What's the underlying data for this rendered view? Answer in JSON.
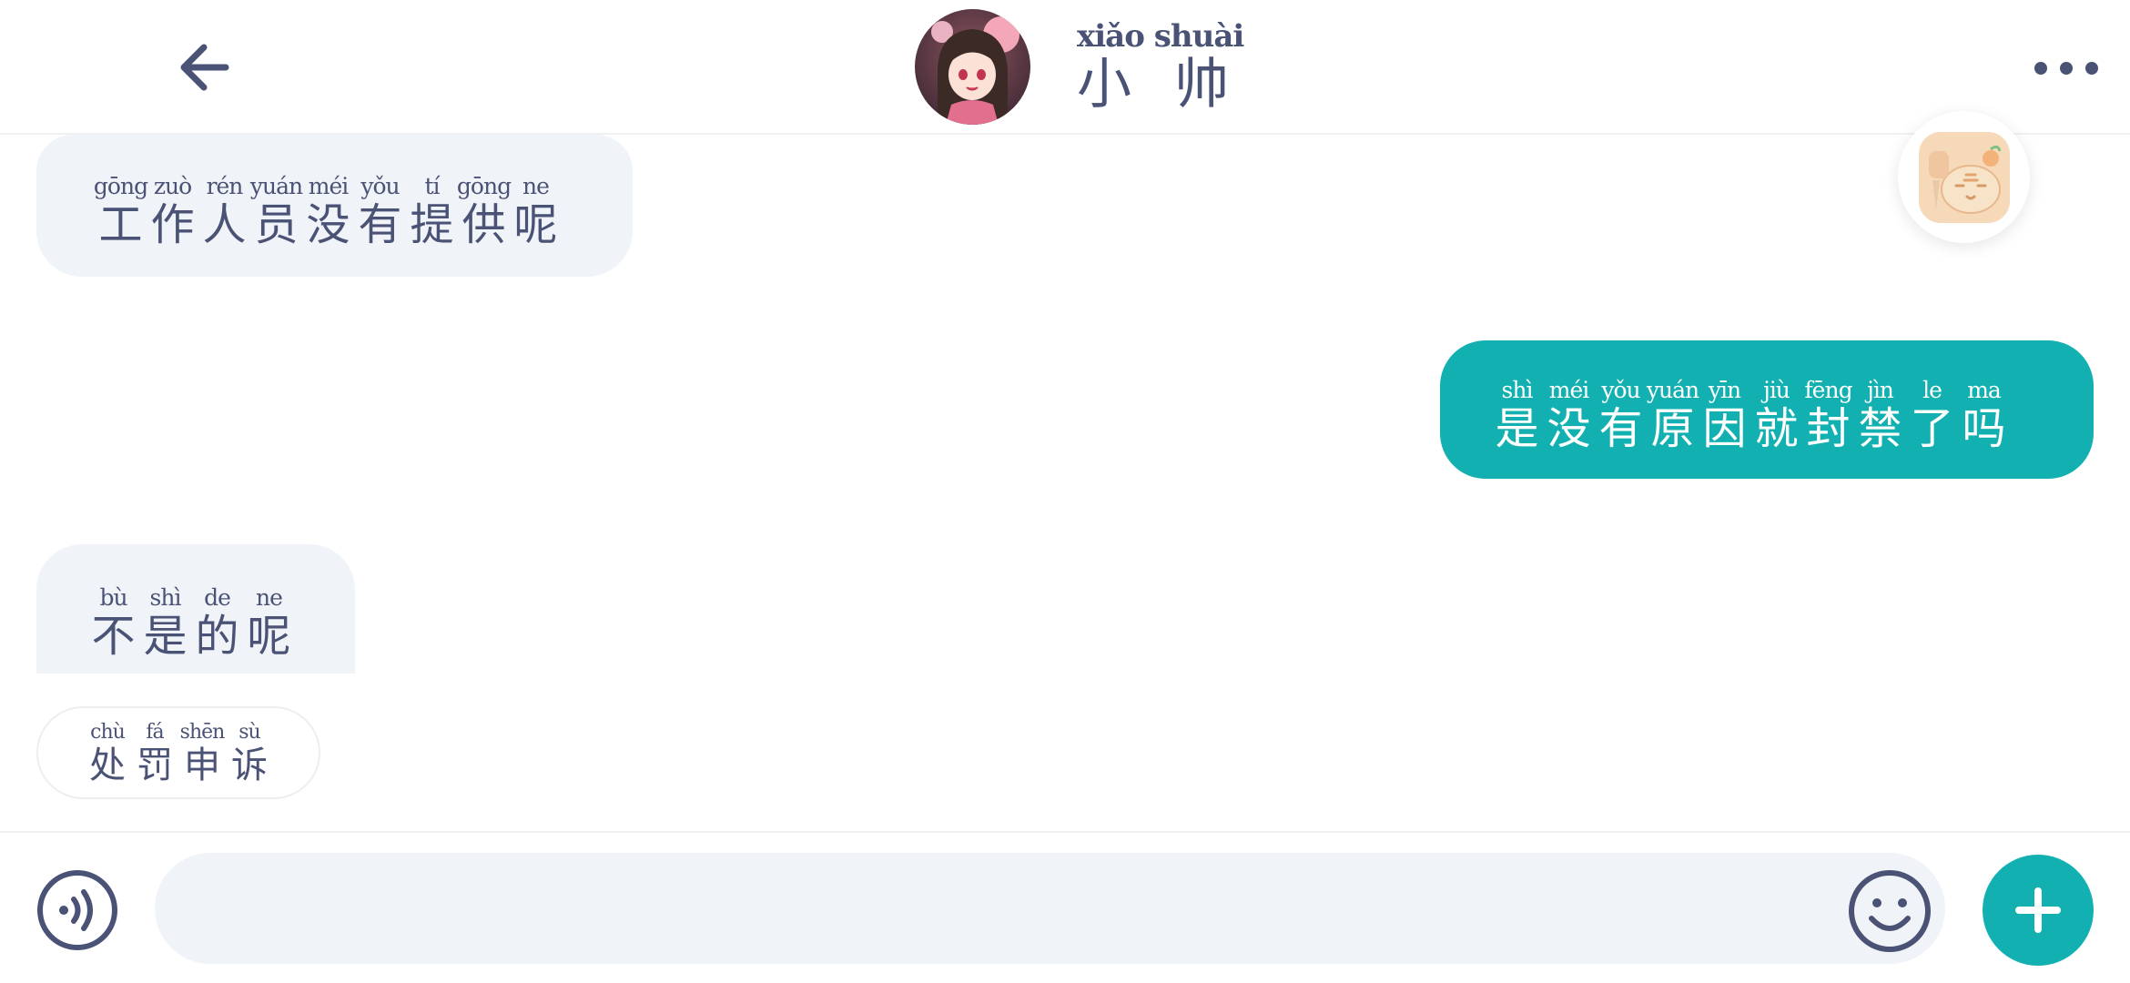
{
  "header": {
    "contact_name_pinyin": "xiǎo shuài",
    "contact_name_hanzi": "小 帅"
  },
  "colors": {
    "accent": "#12b0b0",
    "text": "#4a5275",
    "bubble_in": "#f0f3f7"
  },
  "messages": [
    {
      "direction": "incoming",
      "tokens": [
        {
          "py": "gōng",
          "hz": "工"
        },
        {
          "py": "zuò",
          "hz": "作"
        },
        {
          "py": "rén",
          "hz": "人"
        },
        {
          "py": "yuán",
          "hz": "员"
        },
        {
          "py": "méi",
          "hz": "没"
        },
        {
          "py": "yǒu",
          "hz": "有"
        },
        {
          "py": "tí",
          "hz": "提"
        },
        {
          "py": "gōng",
          "hz": "供"
        },
        {
          "py": "ne",
          "hz": "呢"
        }
      ]
    },
    {
      "direction": "outgoing",
      "tokens": [
        {
          "py": "shì",
          "hz": "是"
        },
        {
          "py": "méi",
          "hz": "没"
        },
        {
          "py": "yǒu",
          "hz": "有"
        },
        {
          "py": "yuán",
          "hz": "原"
        },
        {
          "py": "yīn",
          "hz": "因"
        },
        {
          "py": "jiù",
          "hz": "就"
        },
        {
          "py": "fēng",
          "hz": "封"
        },
        {
          "py": "jìn",
          "hz": "禁"
        },
        {
          "py": "le",
          "hz": "了"
        },
        {
          "py": "ma",
          "hz": "吗"
        }
      ]
    },
    {
      "direction": "incoming",
      "tokens": [
        {
          "py": "bù",
          "hz": "不"
        },
        {
          "py": "shì",
          "hz": "是"
        },
        {
          "py": "de",
          "hz": "的"
        },
        {
          "py": "ne",
          "hz": "呢"
        }
      ]
    }
  ],
  "quick_reply": {
    "tokens": [
      {
        "py": "chù",
        "hz": "处"
      },
      {
        "py": "fá",
        "hz": "罚"
      },
      {
        "py": "shēn",
        "hz": "申"
      },
      {
        "py": "sù",
        "hz": "诉"
      }
    ]
  },
  "input": {
    "value": "",
    "placeholder": ""
  },
  "icons": {
    "back": "arrow-left-icon",
    "more": "more-horizontal-icon",
    "voice": "voice-icon",
    "emoji": "smiley-icon",
    "add": "plus-icon"
  }
}
